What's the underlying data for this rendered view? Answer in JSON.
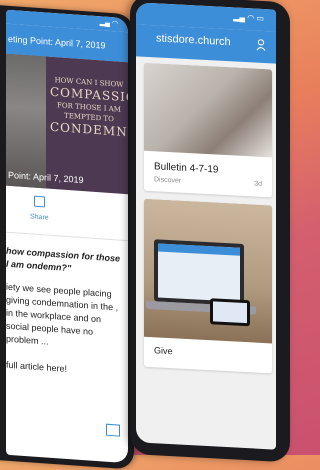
{
  "left_screen": {
    "header_title": "eting Point: April 7, 2019",
    "hero_text": [
      "HOW CAN I SHOW",
      "COMPASSION",
      "FOR THOSE I AM",
      "TEMPTED TO",
      "CONDEMN?"
    ],
    "hero_date": "Point: April 7, 2019",
    "share_label": "Share",
    "question": "how compassion for those I am ondemn?\"",
    "paragraph": "iety we see people placing giving condemnation in the , in the workplace and on social people have no problem ...",
    "link_text": "full article here!"
  },
  "right_screen": {
    "status_time": "",
    "app_title": "stisdore.church",
    "cards": [
      {
        "title": "Bulletin 4-7-19",
        "sub": "Discover",
        "meta": "3d"
      },
      {
        "title": "Give"
      }
    ]
  },
  "colors": {
    "accent": "#3d8ed8",
    "hero_bg": "#4d3952"
  }
}
